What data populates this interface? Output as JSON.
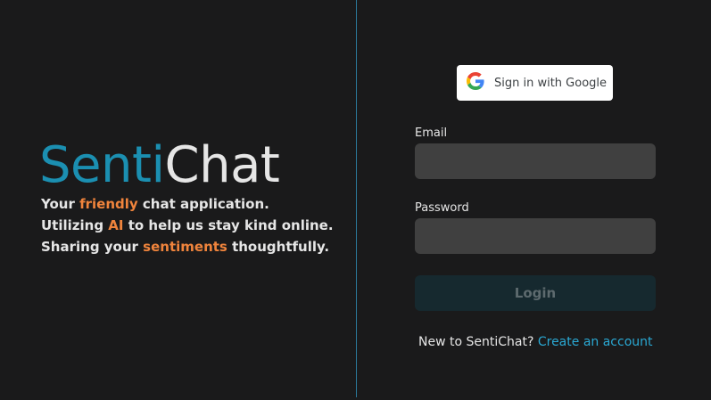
{
  "brand": {
    "name_part1": "Senti",
    "name_part2": "Chat"
  },
  "tagline": {
    "line1": {
      "before": "Your ",
      "highlight": "friendly",
      "after": " chat application."
    },
    "line2": {
      "before": "Utilizing ",
      "highlight": "AI",
      "after": " to help us stay kind online."
    },
    "line3": {
      "before": "Sharing your ",
      "highlight": "sentiments",
      "after": " thoughtfully."
    }
  },
  "auth": {
    "google_label": "Sign in with Google",
    "email_label": "Email",
    "email_value": "",
    "password_label": "Password",
    "password_value": "",
    "login_label": "Login",
    "signup_prompt": "New to SentiChat? ",
    "signup_link": "Create an account"
  },
  "colors": {
    "background": "#1a1a1b",
    "accent": "#1b8fb1",
    "highlight": "#f0843c",
    "link": "#2aa8d3",
    "divider": "#2b7a9b"
  },
  "icons": {
    "google": "google-g-icon"
  }
}
